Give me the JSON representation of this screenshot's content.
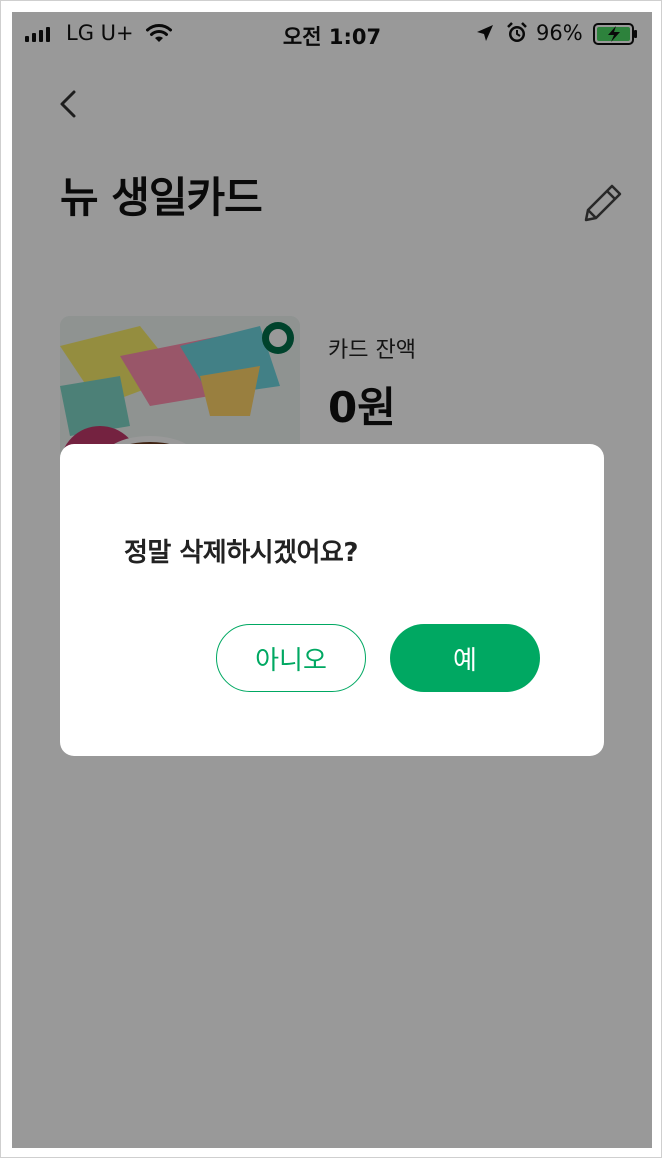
{
  "status_bar": {
    "carrier": "LG U+",
    "time": "오전 1:07",
    "battery_percent": "96%",
    "icons": [
      "signal-icon",
      "wifi-icon",
      "location-arrow-icon",
      "alarm-icon",
      "battery-charging-icon"
    ]
  },
  "header": {
    "back_icon": "chevron-left-icon",
    "title": "뉴 생일카드",
    "edit_icon": "pencil-icon"
  },
  "card": {
    "balance_label": "카드 잔액",
    "balance_value": "0원"
  },
  "dialog": {
    "message": "정말 삭제하시겠어요?",
    "no_label": "아니오",
    "yes_label": "예"
  },
  "colors": {
    "accent_green": "#00a862",
    "overlay": "rgba(0,0,0,0.40)"
  }
}
